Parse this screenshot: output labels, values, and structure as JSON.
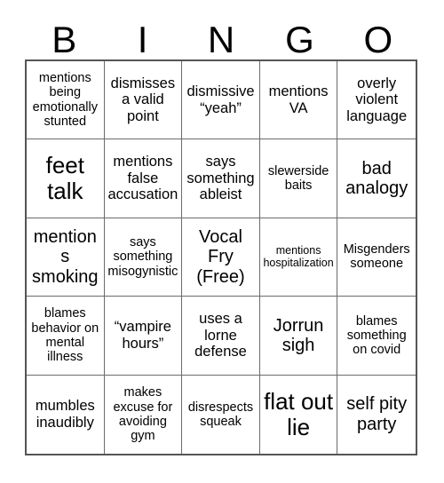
{
  "card": {
    "header_letters": [
      "B",
      "I",
      "N",
      "G",
      "O"
    ],
    "columns": 5,
    "rows": 5,
    "cells": [
      {
        "text": "mentions being emotionally stunted",
        "size": "s",
        "free": false
      },
      {
        "text": "dismisses a valid point",
        "size": "m",
        "free": false
      },
      {
        "text": "dismissive “yeah”",
        "size": "m",
        "free": false
      },
      {
        "text": "mentions VA",
        "size": "m",
        "free": false
      },
      {
        "text": "overly violent language",
        "size": "m",
        "free": false
      },
      {
        "text": "feet talk",
        "size": "xl",
        "free": false
      },
      {
        "text": "mentions false accusation",
        "size": "m",
        "free": false
      },
      {
        "text": "says something ableist",
        "size": "m",
        "free": false
      },
      {
        "text": "slewerside baits",
        "size": "s",
        "free": false
      },
      {
        "text": "bad analogy",
        "size": "l",
        "free": false
      },
      {
        "text": "mentions smoking",
        "size": "l",
        "free": false
      },
      {
        "text": "says something misogynistic",
        "size": "s",
        "free": false
      },
      {
        "text": "Vocal Fry (Free)",
        "size": "l",
        "free": true
      },
      {
        "text": "mentions hospitalization",
        "size": "xs",
        "free": false
      },
      {
        "text": "Misgenders someone",
        "size": "s",
        "free": false
      },
      {
        "text": "blames behavior on mental illness",
        "size": "s",
        "free": false
      },
      {
        "text": "“vampire hours”",
        "size": "m",
        "free": false
      },
      {
        "text": "uses a lorne defense",
        "size": "m",
        "free": false
      },
      {
        "text": "Jorrun sigh",
        "size": "l",
        "free": false
      },
      {
        "text": "blames something on covid",
        "size": "s",
        "free": false
      },
      {
        "text": "mumbles inaudibly",
        "size": "m",
        "free": false
      },
      {
        "text": "makes excuse for avoiding gym",
        "size": "s",
        "free": false
      },
      {
        "text": "disrespects squeak",
        "size": "s",
        "free": false
      },
      {
        "text": "flat out lie",
        "size": "xl",
        "free": false
      },
      {
        "text": "self pity party",
        "size": "l",
        "free": false
      }
    ]
  },
  "colors": {
    "background": "#ffffff",
    "text": "#000000",
    "grid_outer_border": "#555555",
    "grid_inner_border": "#6b6b6b"
  }
}
